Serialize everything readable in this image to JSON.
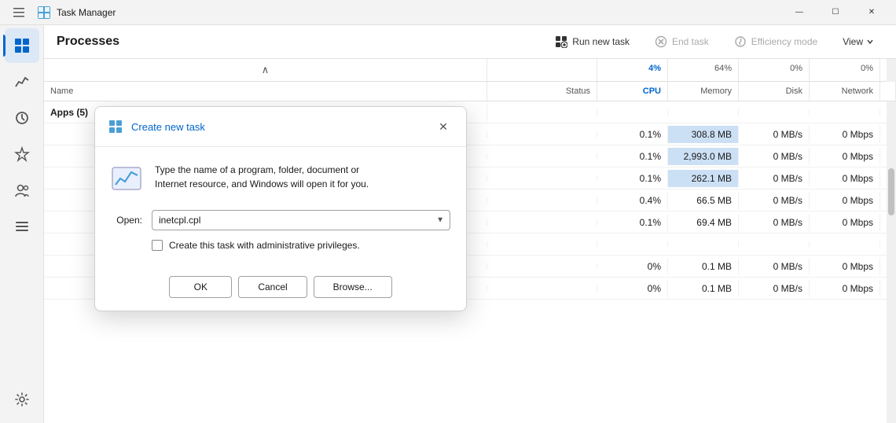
{
  "titleBar": {
    "title": "Task Manager",
    "minimize": "—",
    "maximize": "☐",
    "close": "✕"
  },
  "sidebar": {
    "items": [
      {
        "id": "processes",
        "icon": "grid",
        "active": true
      },
      {
        "id": "performance",
        "icon": "chart"
      },
      {
        "id": "history",
        "icon": "clock"
      },
      {
        "id": "startup",
        "icon": "lightning"
      },
      {
        "id": "users",
        "icon": "users"
      },
      {
        "id": "details",
        "icon": "list"
      }
    ],
    "settingsIcon": "gear"
  },
  "toolbar": {
    "title": "Processes",
    "runNewTask": "Run new task",
    "endTask": "End task",
    "efficiencyMode": "Efficiency mode",
    "view": "View"
  },
  "tableHeader": {
    "sortArrow": "∧",
    "columns": [
      {
        "id": "name",
        "label": "Name",
        "align": "left"
      },
      {
        "id": "status",
        "label": "Status",
        "align": "left"
      },
      {
        "id": "cpu",
        "label": "CPU",
        "sub": "4%",
        "highlight": true
      },
      {
        "id": "memory",
        "label": "Memory",
        "sub": "64%"
      },
      {
        "id": "disk",
        "label": "Disk",
        "sub": "0%"
      },
      {
        "id": "network",
        "label": "Network",
        "sub": "0%"
      }
    ]
  },
  "tableGroups": [
    {
      "label": "Apps (5)",
      "rows": []
    }
  ],
  "tableRows": [
    {
      "name": "",
      "status": "",
      "cpu": "0.1%",
      "memory": "308.8 MB",
      "disk": "0 MB/s",
      "network": "0 Mbps",
      "memHighlight": true
    },
    {
      "name": "",
      "status": "",
      "cpu": "0.1%",
      "memory": "2,993.0 MB",
      "disk": "0 MB/s",
      "network": "0 Mbps",
      "memHighlight": true
    },
    {
      "name": "",
      "status": "",
      "cpu": "0.1%",
      "memory": "262.1 MB",
      "disk": "0 MB/s",
      "network": "0 Mbps",
      "memHighlight": true
    },
    {
      "name": "",
      "status": "",
      "cpu": "0.4%",
      "memory": "66.5 MB",
      "disk": "0 MB/s",
      "network": "0 Mbps",
      "memHighlight": false
    },
    {
      "name": "",
      "status": "",
      "cpu": "0.1%",
      "memory": "69.4 MB",
      "disk": "0 MB/s",
      "network": "0 Mbps",
      "memHighlight": false
    },
    {
      "name": "",
      "status": "",
      "cpu": "",
      "memory": "",
      "disk": "",
      "network": "",
      "memHighlight": false
    },
    {
      "name": "",
      "status": "",
      "cpu": "0%",
      "memory": "0.1 MB",
      "disk": "0 MB/s",
      "network": "0 Mbps",
      "memHighlight": false
    },
    {
      "name": "",
      "status": "",
      "cpu": "0%",
      "memory": "0.1 MB",
      "disk": "0 MB/s",
      "network": "0 Mbps",
      "memHighlight": false
    }
  ],
  "dialog": {
    "title": "Create new task",
    "closeBtn": "✕",
    "descriptionLine1": "Type the name of a program, folder, document or",
    "descriptionLine2": "Internet resource, and Windows will open it for you.",
    "openLabel": "Open:",
    "inputValue": "inetcpl.cpl",
    "inputPlaceholder": "",
    "checkboxLabel": "Create this task with administrative privileges.",
    "okBtn": "OK",
    "cancelBtn": "Cancel",
    "browseBtn": "Browse..."
  }
}
